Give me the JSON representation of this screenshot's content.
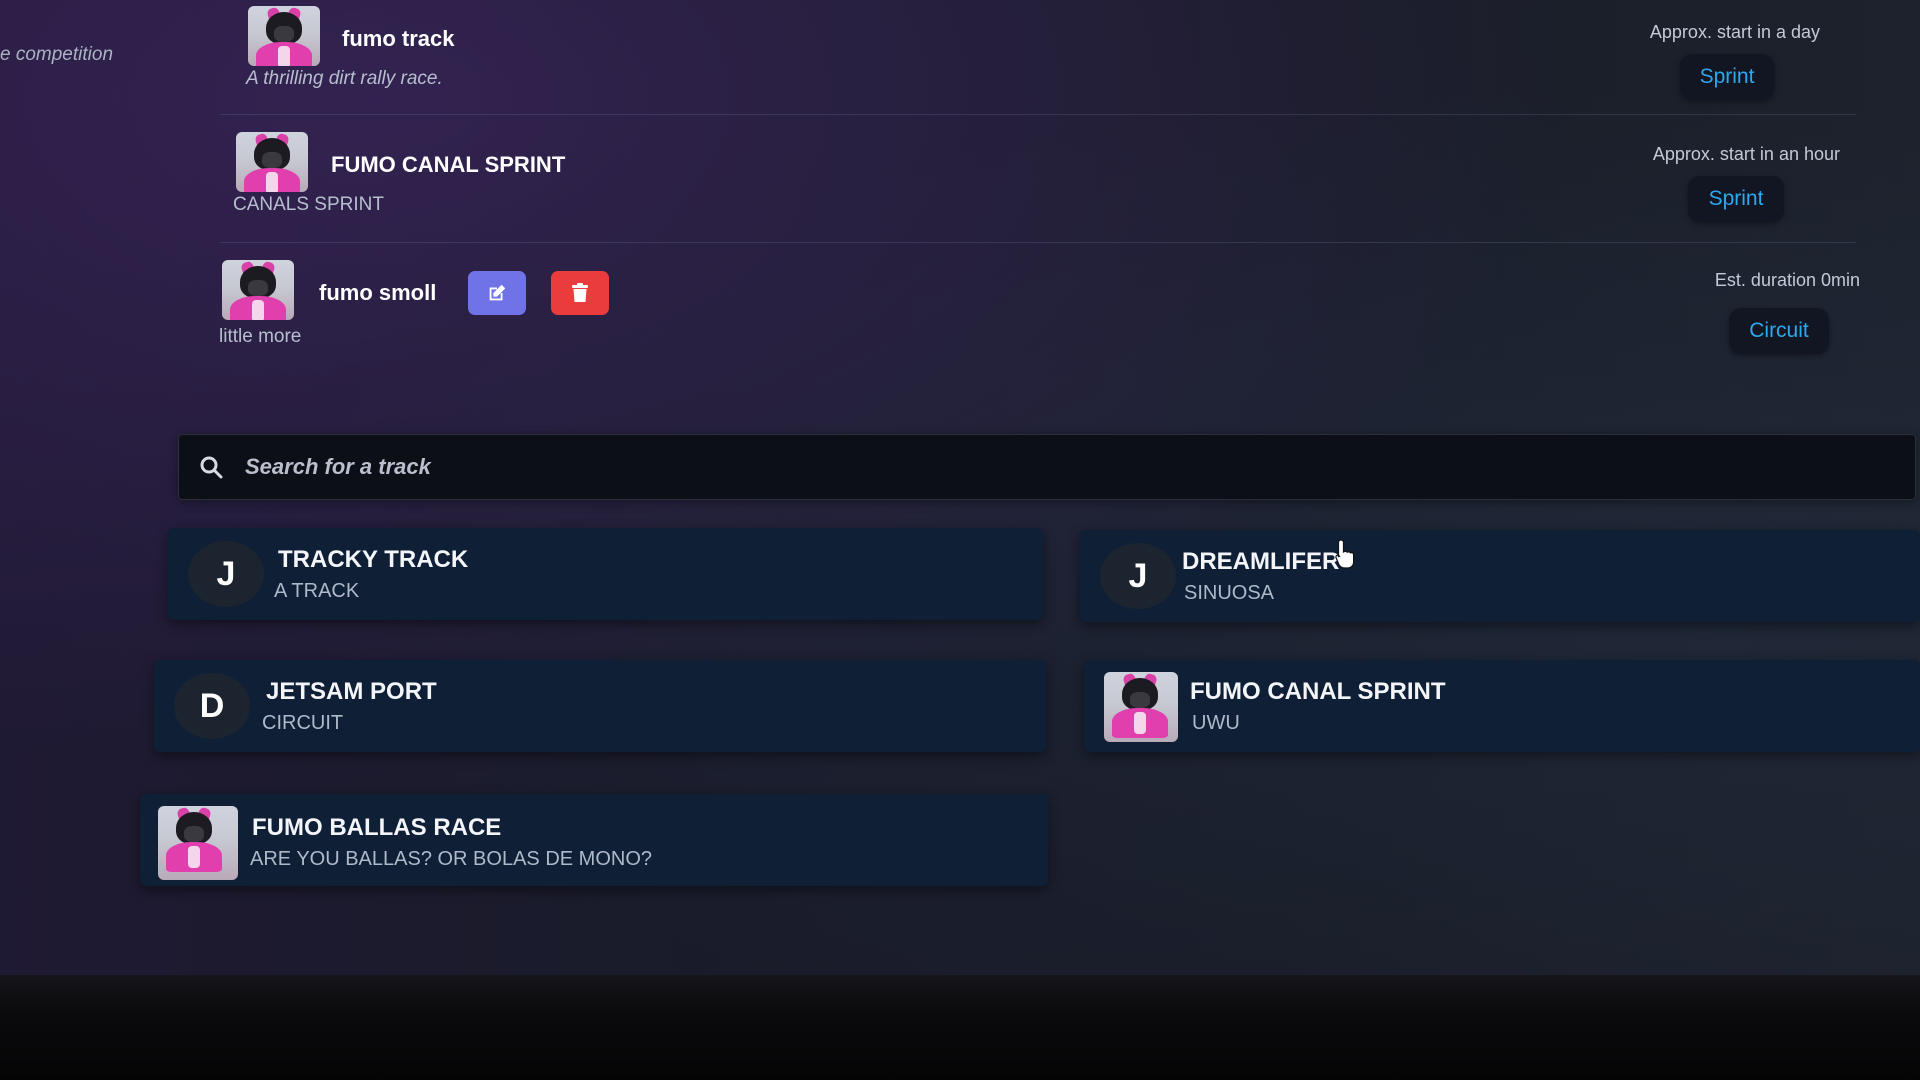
{
  "sidebar": {
    "competition_label": "e competition"
  },
  "events": [
    {
      "title": "fumo track",
      "subtitle": "A thrilling dirt rally race.",
      "meta": "Approx. start in a day",
      "mode": "Sprint"
    },
    {
      "title": "FUMO CANAL SPRINT",
      "subtitle": "CANALS SPRINT",
      "meta": "Approx. start in an hour",
      "mode": "Sprint"
    },
    {
      "title": "fumo smoll",
      "subtitle": "little more",
      "meta": "Est. duration 0min",
      "mode": "Circuit"
    }
  ],
  "search": {
    "placeholder": "Search for a track",
    "value": ""
  },
  "tracks": [
    {
      "initial": "J",
      "title": "TRACKY TRACK",
      "subtitle": "A TRACK"
    },
    {
      "initial": "J",
      "title": "DREAMLIFER",
      "subtitle": "SINUOSA"
    },
    {
      "initial": "D",
      "title": "JETSAM PORT",
      "subtitle": "CIRCUIT"
    },
    {
      "initial": "",
      "title": "FUMO CANAL SPRINT",
      "subtitle": "UWU"
    },
    {
      "initial": "",
      "title": "FUMO BALLAS RACE",
      "subtitle": "ARE YOU BALLAS? OR BOLAS DE MONO?"
    }
  ],
  "colors": {
    "accent_blue": "#2da8ef",
    "edit_button": "#6f73e6",
    "delete_button": "#ea3c3c",
    "card_bg": "#0f1f36"
  },
  "icons": {
    "edit": "pencil-square-icon",
    "delete": "trash-icon",
    "search": "magnifier-icon",
    "cursor": "hand-pointer-icon"
  }
}
